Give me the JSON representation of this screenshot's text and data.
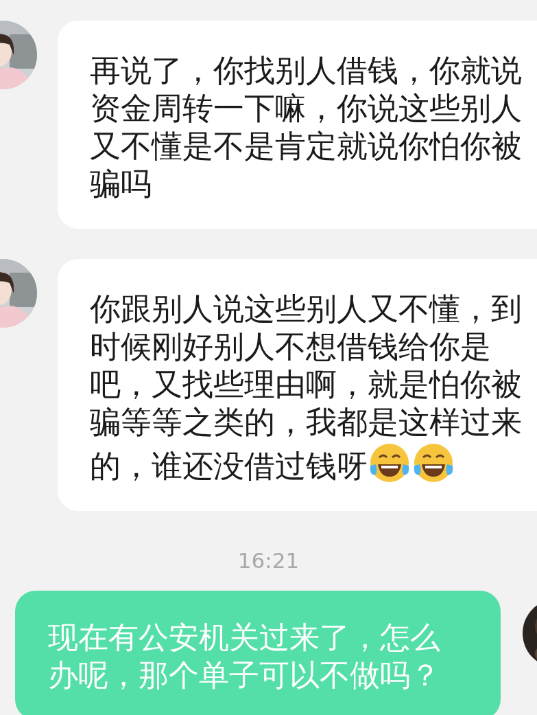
{
  "messages": [
    {
      "kind": "incoming",
      "parts": [
        {
          "kind": "text",
          "text": "再说了，你找别人借钱，你就说资金周转一下嘛，你说这些别人又不懂是不是肯定就说你怕你被骗吗"
        }
      ]
    },
    {
      "kind": "incoming",
      "parts": [
        {
          "kind": "text",
          "text": "你跟别人说这些别人又不懂，到时候刚好别人不想借钱给你是吧，又找些理由啊，就是怕你被骗等等之类的，我都是这样过来的，谁还没借过钱呀"
        },
        {
          "kind": "emoji"
        },
        {
          "kind": "emoji"
        }
      ]
    },
    {
      "kind": "time",
      "text": "16:21"
    },
    {
      "kind": "outgoing",
      "parts": [
        {
          "kind": "text",
          "text": "现在有公安机关过来了，怎么办呢，那个单子可以不做吗？"
        }
      ]
    }
  ]
}
